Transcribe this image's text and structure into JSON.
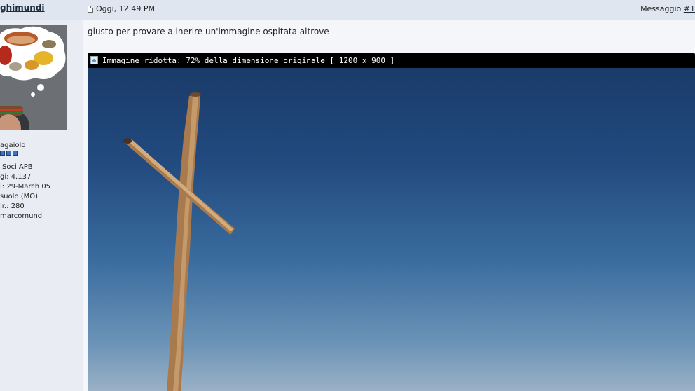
{
  "user": {
    "name": "ghimundi",
    "rank": "agaiolo",
    "pips": 3,
    "info_lines": [
      "Soci APB",
      "gi: 4.137",
      "l: 29-March 05",
      "suolo (MO)",
      "lr.: 280",
      "marcomundi"
    ]
  },
  "post": {
    "date": "Oggi, 12:49 PM",
    "number_label": "Messaggio",
    "number_link": "#1",
    "text": "giusto per provare a inerire un'immagine ospitata altrove"
  },
  "image": {
    "resize_notice": "Immagine ridotta: 72% della dimensione originale [ 1200 x 900 ]"
  },
  "icons": {
    "post_date": "document-icon",
    "image_notice": "image-icon"
  },
  "colors": {
    "header_bg": "#dfe6ef",
    "pip": "#3d74c0",
    "sky_top": "#1a3b69",
    "sky_bottom": "#9ab1c6"
  }
}
